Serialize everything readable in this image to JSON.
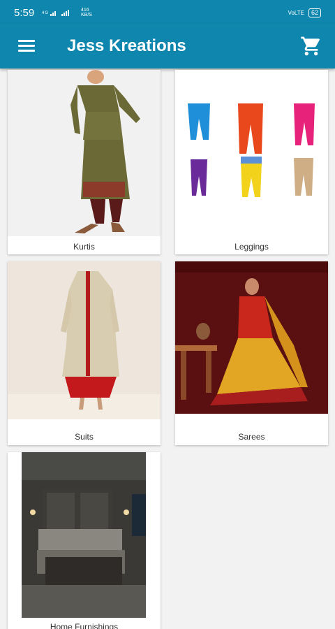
{
  "status": {
    "time": "5:59",
    "signal_text": "⁵ᴳ ᵃˡˡ ▮▮▮",
    "speed_value": "416",
    "speed_unit": "KB/S",
    "network": "VoLTE",
    "battery": "62"
  },
  "appbar": {
    "title": "Jess Kreations",
    "menu_icon": "menu-icon",
    "cart_icon": "cart-icon"
  },
  "categories": [
    {
      "label": "Kurtis",
      "image": "kurti-image"
    },
    {
      "label": "Leggings",
      "image": "leggings-image"
    },
    {
      "label": "Suits",
      "image": "suit-image"
    },
    {
      "label": "Sarees",
      "image": "saree-image"
    },
    {
      "label": "Home Furnishings",
      "image": "bedroom-image"
    }
  ],
  "colors": {
    "primary": "#0e86ad",
    "background": "#f2f2f2",
    "card": "#ffffff"
  }
}
